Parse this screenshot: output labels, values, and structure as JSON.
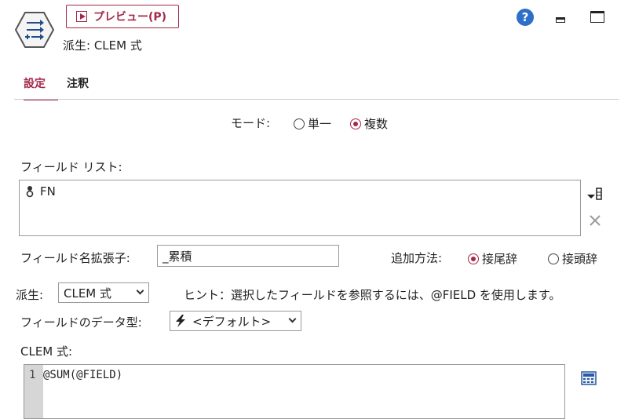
{
  "header": {
    "preview_label": "プレビュー(P)",
    "node_title": "派生: CLEM 式",
    "help_glyph": "?"
  },
  "tabs": [
    {
      "label": "設定",
      "active": true
    },
    {
      "label": "注釈",
      "active": false
    }
  ],
  "mode": {
    "label": "モード:",
    "options": [
      {
        "label": "単一",
        "selected": false
      },
      {
        "label": "複数",
        "selected": true
      }
    ]
  },
  "field_list": {
    "label": "フィールド リスト:",
    "items": [
      "FN"
    ]
  },
  "extension": {
    "label": "フィールド名拡張子:",
    "value": "_累積"
  },
  "add_method": {
    "label": "追加方法:",
    "options": [
      {
        "label": "接尾辞",
        "selected": true
      },
      {
        "label": "接頭辞",
        "selected": false
      }
    ]
  },
  "derive": {
    "label": "派生:",
    "selected": "CLEM 式",
    "hint": "ヒント：選択したフィールドを参照するには、@FIELD を使用します。"
  },
  "data_type": {
    "label": "フィールドのデータ型:",
    "selected": "<デフォルト>"
  },
  "clem": {
    "label": "CLEM 式:",
    "line_number": "1",
    "code": "@SUM(@FIELD)"
  },
  "colors": {
    "accent": "#a5284a",
    "help": "#2e6fc7"
  }
}
